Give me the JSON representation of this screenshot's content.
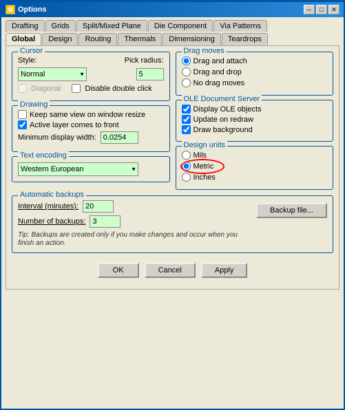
{
  "window": {
    "title": "Options",
    "icon": "⚙"
  },
  "titlebar_buttons": {
    "minimize": "─",
    "maximize": "□",
    "close": "✕"
  },
  "tabs_row1": [
    {
      "label": "Drafting",
      "active": false
    },
    {
      "label": "Grids",
      "active": false
    },
    {
      "label": "Split/Mixed Plane",
      "active": false
    },
    {
      "label": "Die Component",
      "active": false
    },
    {
      "label": "Via Patterns",
      "active": false
    }
  ],
  "tabs_row2": [
    {
      "label": "Global",
      "active": true
    },
    {
      "label": "Design",
      "active": false
    },
    {
      "label": "Routing",
      "active": false
    },
    {
      "label": "Thermals",
      "active": false
    },
    {
      "label": "Dimensioning",
      "active": false
    },
    {
      "label": "Teardrops",
      "active": false
    }
  ],
  "cursor": {
    "label": "Cursor",
    "style_label": "Style:",
    "style_value": "Normal",
    "pick_radius_label": "Pick radius:",
    "pick_radius_value": "5",
    "diagonal_label": "Diagonal",
    "disable_dbl_click_label": "Disable double click"
  },
  "drag_moves": {
    "label": "Drag moves",
    "option1": "Drag and attach",
    "option2": "Drag and drop",
    "option3": "No drag moves",
    "selected": "option1"
  },
  "drawing": {
    "label": "Drawing",
    "check1": "Keep same view on window resize",
    "check1_checked": false,
    "check2": "Active layer comes to front",
    "check2_checked": true,
    "min_display_label": "Minimum display width:",
    "min_display_value": "0.0254"
  },
  "ole_document": {
    "label": "OLE Document Server",
    "check1": "Display OLE objects",
    "check1_checked": true,
    "check2": "Update on redraw",
    "check2_checked": true,
    "check3": "Draw background",
    "check3_checked": true
  },
  "text_encoding": {
    "label": "Text encoding",
    "value": "Western European"
  },
  "design_units": {
    "label": "Design units",
    "option1": "Mils",
    "option2": "Metric",
    "option3": "Inches",
    "selected": "option2"
  },
  "auto_backups": {
    "label": "Automatic backups",
    "interval_label": "Interval (minutes):",
    "interval_value": "20",
    "num_backups_label": "Number of backups:",
    "num_backups_value": "3",
    "tip": "Tip: Backups are created only if you make changes and occur when you finish an action.",
    "backup_file_btn": "Backup file..."
  },
  "buttons": {
    "ok": "OK",
    "cancel": "Cancel",
    "apply": "Apply"
  }
}
